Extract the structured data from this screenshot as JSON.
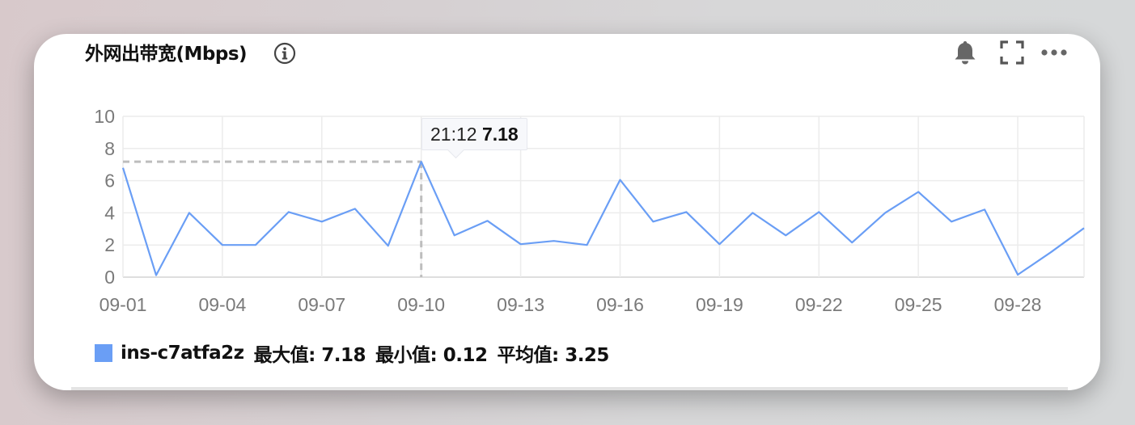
{
  "widget": {
    "title": "外网出带宽(Mbps)",
    "icons": [
      "info-icon",
      "bell-icon",
      "fullscreen-icon",
      "more-icon"
    ]
  },
  "tooltip": {
    "time": "21:12",
    "value": "7.18"
  },
  "legend": {
    "series_name": "ins-c7atfa2z",
    "max_label": "最大值: 7.18",
    "min_label": "最小值: 0.12",
    "avg_label": "平均值: 3.25",
    "color": "#6a9ef5"
  },
  "chart_data": {
    "type": "line",
    "title": "外网出带宽(Mbps)",
    "xlabel": "",
    "ylabel": "",
    "ylim": [
      0,
      10
    ],
    "y_ticks": [
      "0",
      "2",
      "4",
      "6",
      "8",
      "10"
    ],
    "x_ticks": [
      "09-01",
      "09-04",
      "09-07",
      "09-10",
      "09-13",
      "09-16",
      "09-19",
      "09-22",
      "09-25",
      "09-28"
    ],
    "x_range": [
      "09-01",
      "09-30"
    ],
    "grid": true,
    "legend_position": "bottom-left",
    "highlight": {
      "x": "09-10",
      "y": 7.18,
      "label_time": "21:12"
    },
    "series": [
      {
        "name": "ins-c7atfa2z",
        "color": "#6a9ef5",
        "x": [
          "09-01",
          "09-02",
          "09-03",
          "09-04",
          "09-05",
          "09-06",
          "09-07",
          "09-08",
          "09-09",
          "09-10",
          "09-11",
          "09-12",
          "09-13",
          "09-14",
          "09-15",
          "09-16",
          "09-17",
          "09-18",
          "09-19",
          "09-20",
          "09-21",
          "09-22",
          "09-23",
          "09-24",
          "09-25",
          "09-26",
          "09-27",
          "09-28",
          "09-29",
          "09-30"
        ],
        "values": [
          6.8,
          0.12,
          4.0,
          2.0,
          2.0,
          4.05,
          3.45,
          4.25,
          1.95,
          7.18,
          2.6,
          3.5,
          2.05,
          2.25,
          2.0,
          6.05,
          3.45,
          4.05,
          2.05,
          4.0,
          2.6,
          4.05,
          2.15,
          4.0,
          5.3,
          3.45,
          4.2,
          0.15,
          1.55,
          3.05
        ]
      }
    ]
  }
}
